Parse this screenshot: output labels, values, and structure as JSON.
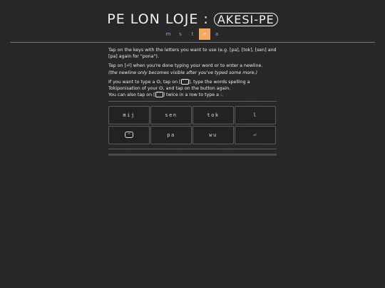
{
  "header": {
    "title_main": "PE LON LOJE : ",
    "title_oval": "AKESI-PE"
  },
  "nav": {
    "items": [
      {
        "label": "m",
        "active": false
      },
      {
        "label": "s",
        "active": false
      },
      {
        "label": "t",
        "active": false
      },
      {
        "label": "e",
        "active": true
      },
      {
        "label": "a",
        "active": false
      }
    ]
  },
  "instructions": {
    "p1": "Tap on the keys with the letters you want to use (e.g. [pa], [tok], [sen] and [pa] again for \"pona\").",
    "p2": "Tap on [⏎] when you're done typing your word or to enter a newline.",
    "p2_note": "(the newline only becomes visible after you've typed some more.)",
    "p3a": "If you want to type a ⵙ, tap on [",
    "p3b": "], type the words spelling a Tokiponisation of your ⵙ, and tap on the button again.",
    "p4a": "You can also tap on [",
    "p4b": "] twice in a row to type a :.",
    "cartouche_glyph": "⌒"
  },
  "keypad": {
    "keys": [
      "mij",
      "sen",
      "tok",
      "l",
      "⌒",
      "pa",
      "wu",
      "⏎"
    ]
  }
}
